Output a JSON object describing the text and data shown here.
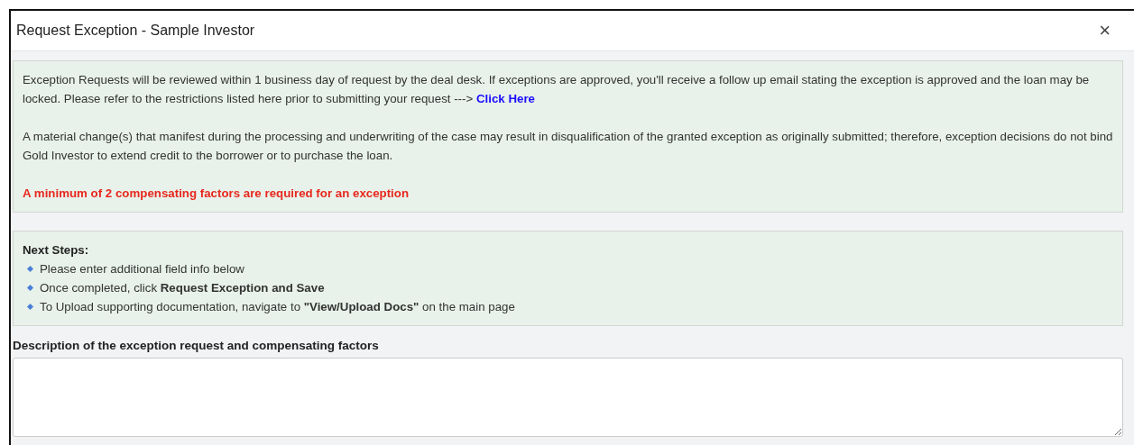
{
  "dialog": {
    "title": "Request Exception - Sample Investor",
    "close": "×"
  },
  "notice": {
    "intro": "Exception Requests will be reviewed within 1 business day of request by the deal desk. If exceptions are approved, you'll receive a follow up email stating the exception is approved and the loan may be locked. Please refer to the restrictions listed here prior to submitting your request --->",
    "link": "Click Here",
    "disclaimer": "A material change(s) that manifest during the processing and underwriting of the case may result in disqualification of the granted exception as originally submitted; therefore, exception decisions do not bind Gold Investor to extend credit to the borrower or to purchase the loan.",
    "warning": "A minimum of 2 compensating factors are required for an exception"
  },
  "next_steps": {
    "heading": "Next Steps:",
    "items": [
      "Please enter additional field info below",
      "Once completed, click **Request Exception and Save**",
      "To Upload supporting documentation, navigate to **\"View/Upload Docs\"** on the main page"
    ]
  },
  "description": {
    "label": "Description of the exception request and compensating factors"
  }
}
